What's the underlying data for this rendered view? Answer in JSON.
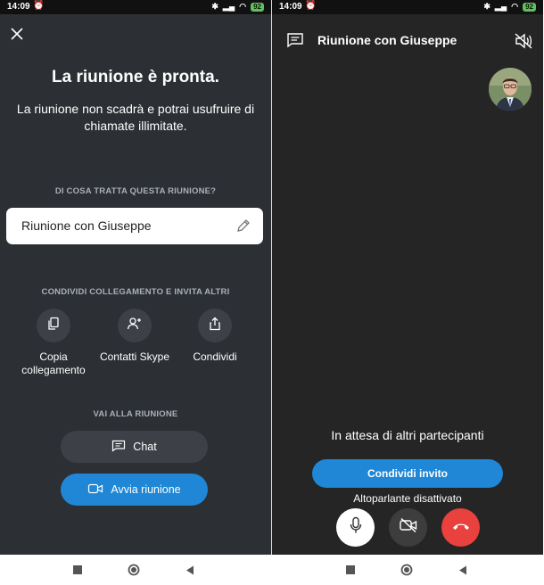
{
  "left": {
    "status": {
      "time": "14:09",
      "battery": "92"
    },
    "title": "La riunione è pronta.",
    "subtitle": "La riunione non scadrà e potrai usufruire di chiamate illimitate.",
    "topic_label": "DI COSA TRATTA QUESTA RIUNIONE?",
    "topic_value": "Riunione con Giuseppe",
    "share_label": "CONDIVIDI COLLEGAMENTO E INVITA ALTRI",
    "share_actions": [
      {
        "label_line1": "Copia",
        "label_line2": "collegamento",
        "icon": "copy-icon"
      },
      {
        "label_line1": "Contatti Skype",
        "label_line2": "",
        "icon": "add-contact-icon"
      },
      {
        "label_line1": "Condividi",
        "label_line2": "",
        "icon": "share-icon"
      }
    ],
    "go_label": "VAI ALLA RIUNIONE",
    "chat_button": "Chat",
    "start_button": "Avvia riunione"
  },
  "right": {
    "status": {
      "time": "14:09",
      "battery": "92"
    },
    "meeting_title": "Riunione con Giuseppe",
    "waiting_text": "In attesa di altri partecipanti",
    "invite_button": "Condividi invito",
    "speaker_status": "Altoparlante disattivato"
  },
  "colors": {
    "left_bg": "#2c2f33",
    "right_bg": "#252525",
    "accent_blue": "#1f87d5",
    "end_call_red": "#e8413e"
  }
}
